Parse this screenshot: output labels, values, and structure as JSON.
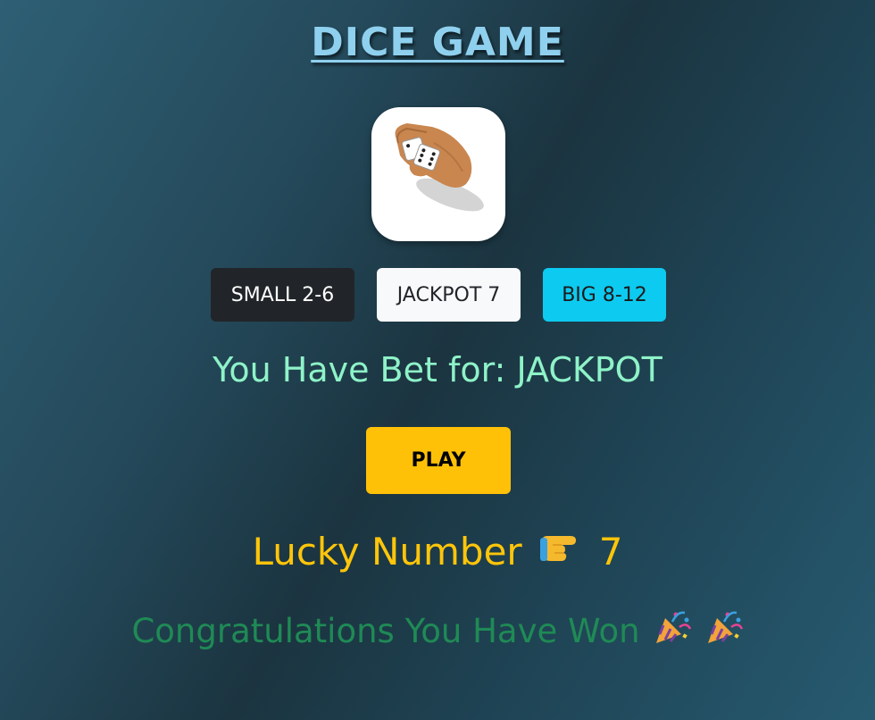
{
  "title": "DICE GAME",
  "dice_image": {
    "icon": "hand-rolling-dice-icon"
  },
  "bet_options": [
    {
      "label": "SMALL 2-6",
      "color": "#212529"
    },
    {
      "label": "JACKPOT 7",
      "color": "#f8f9fa"
    },
    {
      "label": "BIG 8-12",
      "color": "#0dcaf0"
    }
  ],
  "bet_status": "You Have Bet for: JACKPOT",
  "play_label": "PLAY",
  "lucky": {
    "label": "Lucky Number",
    "icon": "pointing-finger-icon",
    "number": "7"
  },
  "result": {
    "message": "Congratulations You Have Won",
    "icons": [
      "party-popper-icon",
      "party-popper-icon"
    ]
  },
  "colors": {
    "title": "#8fd0ee",
    "bet_status": "#8ef3c8",
    "play_button": "#ffc107",
    "lucky_text": "#ffc50a",
    "result_text": "#1f8a55"
  }
}
